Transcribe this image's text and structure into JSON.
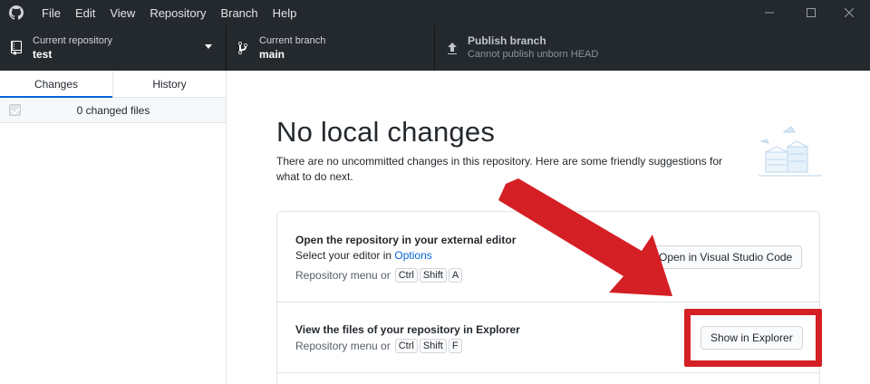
{
  "menu": [
    "File",
    "Edit",
    "View",
    "Repository",
    "Branch",
    "Help"
  ],
  "toolbar": {
    "repo_label": "Current repository",
    "repo_value": "test",
    "branch_label": "Current branch",
    "branch_value": "main",
    "publish_label": "Publish branch",
    "publish_value": "Cannot publish unborn HEAD"
  },
  "sidebar": {
    "tabs": [
      "Changes",
      "History"
    ],
    "changed_files": "0 changed files"
  },
  "main": {
    "title": "No local changes",
    "subtitle": "There are no uncommitted changes in this repository. Here are some friendly suggestions for what to do next."
  },
  "suggestions": [
    {
      "title": "Open the repository in your external editor",
      "line_prefix": "Select your editor in ",
      "line_link": "Options",
      "keys_prefix": "Repository menu or",
      "keys": [
        "Ctrl",
        "Shift",
        "A"
      ],
      "button": "Open in Visual Studio Code"
    },
    {
      "title": "View the files of your repository in Explorer",
      "keys_prefix": "Repository menu or",
      "keys": [
        "Ctrl",
        "Shift",
        "F"
      ],
      "button": "Show in Explorer"
    }
  ],
  "colors": {
    "titlebar_bg": "#24292e",
    "accent": "#0366d6",
    "annotation_red": "#d41f24"
  }
}
